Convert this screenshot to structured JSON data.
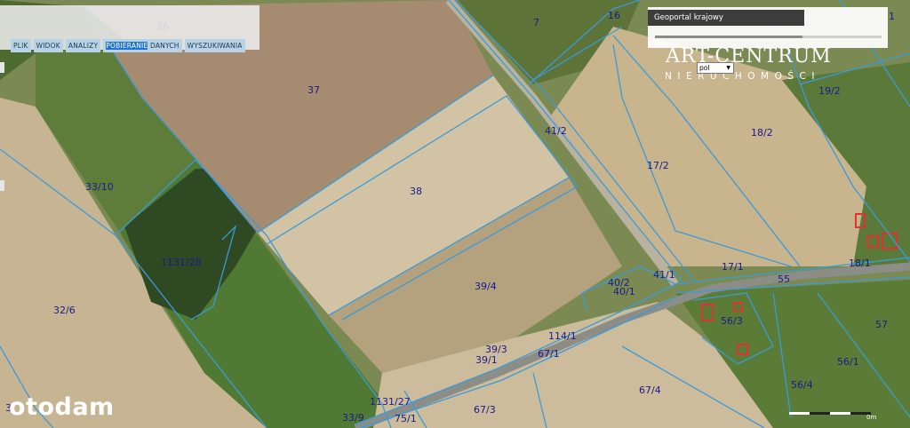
{
  "toolbar": {
    "menu": [
      {
        "label": "PLIK"
      },
      {
        "label": "WIDOK"
      },
      {
        "label": "ANALIZY"
      },
      {
        "label_highlighted": "POBIERANIE",
        "label_rest": " DANYCH"
      },
      {
        "label": "WYSZUKIWANIA"
      }
    ]
  },
  "geoportal": {
    "title": "Geoportal krajowy",
    "transparency_level": 0.65
  },
  "watermark": {
    "line1": "ART-CENTRUM",
    "line2": "NIERUCHOMOŚCI"
  },
  "language_select": {
    "value": "pol"
  },
  "brand": {
    "name": "otodam"
  },
  "scale": {
    "label": "0m"
  },
  "parcels": {
    "p36": "36",
    "p7": "7",
    "p16": "16",
    "p1": "1",
    "p37": "37",
    "p19_2": "19/2",
    "p41_2": "41/2",
    "p18_2": "18/2",
    "p33_10": "33/10",
    "p17_2": "17/2",
    "p38": "38",
    "p1131_28": "1131/28",
    "p18_1": "18/1",
    "p17_1": "17/1",
    "p41_1": "41/1",
    "p55": "55",
    "p40_2": "40/2",
    "p40_1": "40/1",
    "p39_4": "39/4",
    "p32_6": "32/6",
    "p56_3": "56/3",
    "p57": "57",
    "p114_1": "114/1",
    "p39_3": "39/3",
    "p39_1": "39/1",
    "p67_1": "67/1",
    "p56_1": "56/1",
    "p67_4": "67/4",
    "p56_4": "56/4",
    "p1131_27": "1131/27",
    "p67_3": "67/3",
    "p33_9": "33/9",
    "p75_1": "75/1",
    "p3_": "3/"
  },
  "colors": {
    "parcel_border": "#3a9bd9",
    "parcel_label": "#1a1a8c",
    "toolbar_button": "#b9d3e6",
    "toolbar_highlight": "#1e73d2",
    "geoportal_header": "#3d3d3d",
    "building_outline": "#e03030"
  }
}
